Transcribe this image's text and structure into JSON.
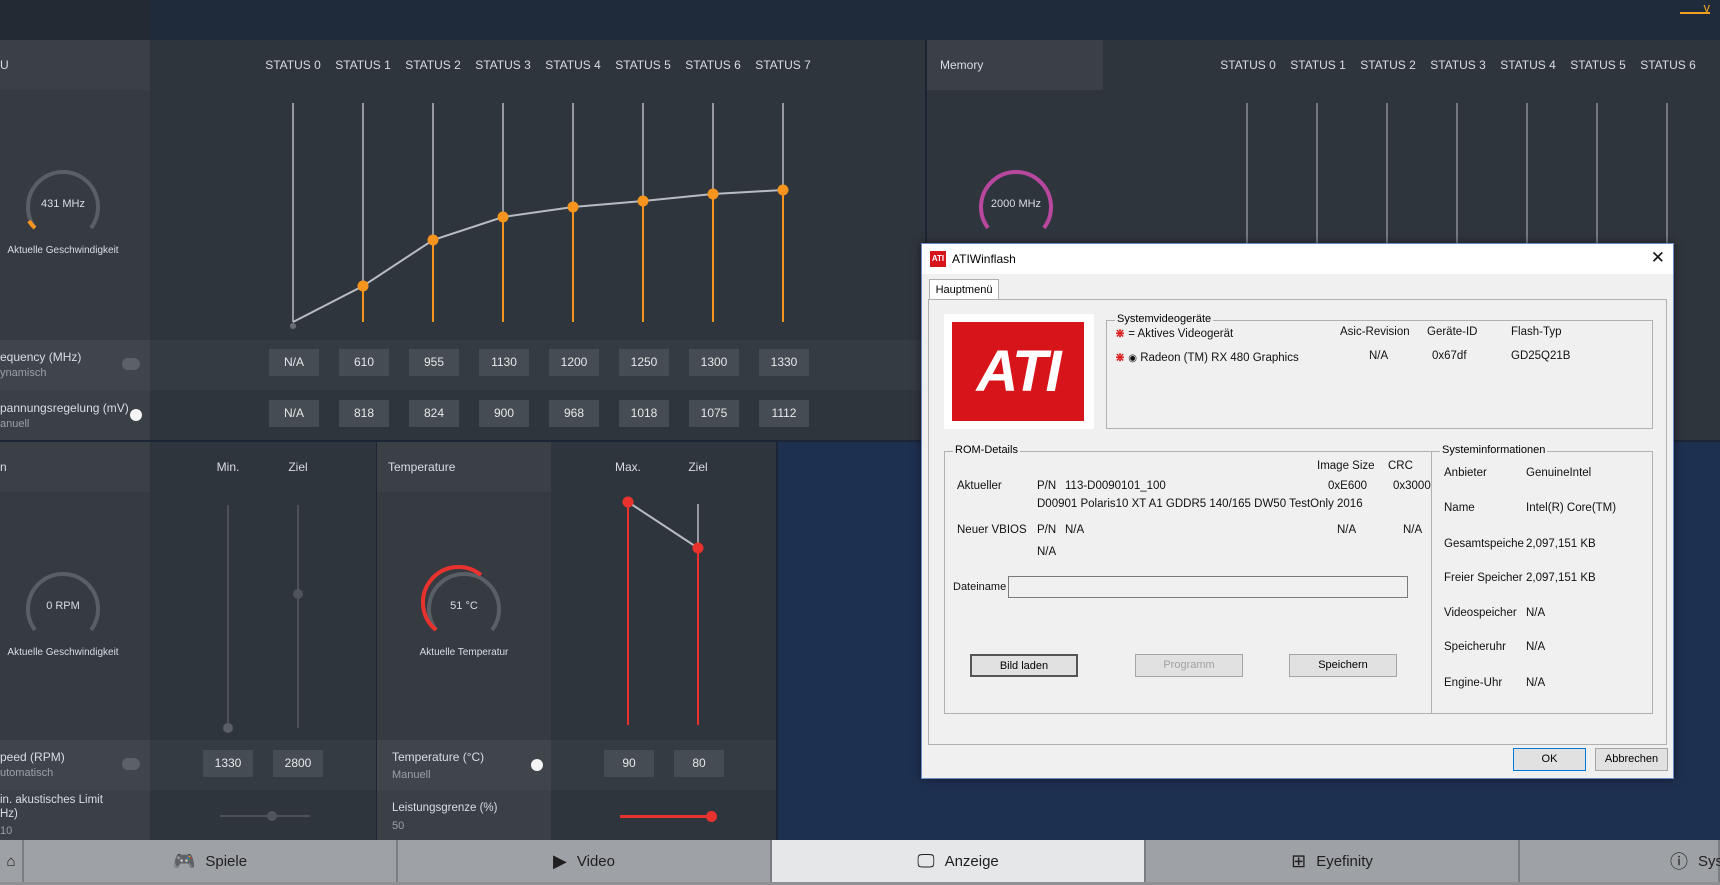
{
  "gpu": {
    "header": "U",
    "states": [
      "STATUS 0",
      "STATUS 1",
      "STATUS 2",
      "STATUS 3",
      "STATUS 4",
      "STATUS 5",
      "STATUS 6",
      "STATUS 7"
    ],
    "gauge_value": "431 MHz",
    "gauge_label": "Aktuelle Geschwindigkeit",
    "freq_label": "equency (MHz)",
    "freq_mode": "ynamisch",
    "freq_values": [
      "N/A",
      "610",
      "955",
      "1130",
      "1200",
      "1250",
      "1300",
      "1330"
    ],
    "volt_label": "pannungsregelung (mV)",
    "volt_mode": "anuell",
    "volt_values": [
      "N/A",
      "818",
      "824",
      "900",
      "968",
      "1018",
      "1075",
      "1112"
    ]
  },
  "memory": {
    "header": "Memory",
    "states": [
      "STATUS 0",
      "STATUS 1",
      "STATUS 2",
      "STATUS 3",
      "STATUS 4",
      "STATUS 5",
      "STATUS 6"
    ],
    "gauge_value": "2000 MHz"
  },
  "fan": {
    "header": "n",
    "min_label": "Min.",
    "target_label": "Ziel",
    "gauge_value": "0 RPM",
    "gauge_label": "Aktuelle Geschwindigkeit",
    "speed_label": "peed (RPM)",
    "speed_mode": "utomatisch",
    "speed_min": "1330",
    "speed_target": "2800",
    "acoustic_label_1": "in. akustisches Limit",
    "acoustic_label_2": "Hz)",
    "acoustic_value": "10"
  },
  "temperature": {
    "header": "Temperature",
    "max_label": "Max.",
    "target_label": "Ziel",
    "gauge_value": "51 °C",
    "gauge_label": "Aktuelle Temperatur",
    "temp_label": "Temperature (°C)",
    "temp_mode": "Manuell",
    "temp_max": "90",
    "temp_target": "80",
    "power_label": "Leistungsgrenze (%)",
    "power_value": "50"
  },
  "nav": {
    "items": [
      {
        "label": "Spiele",
        "icon": "gamepad-icon"
      },
      {
        "label": "Video",
        "icon": "play-icon"
      },
      {
        "label": "Anzeige",
        "icon": "monitor-icon"
      },
      {
        "label": "Eyefinity",
        "icon": "eyefinity-icon"
      },
      {
        "label": "Sys",
        "icon": "info-icon"
      }
    ]
  },
  "dialog": {
    "title": "ATIWinflash",
    "tab": "Hauptmenü",
    "logo_text": "ATI",
    "sysvideo": {
      "title": "Systemvideogeräte",
      "legend": "= Aktives Videogerät",
      "col_asic": "Asic-Revision",
      "col_device": "Geräte-ID",
      "col_flash": "Flash-Typ",
      "device": "Radeon (TM) RX 480 Graphics",
      "asic": "N/A",
      "device_id": "0x67df",
      "flash": "GD25Q21B"
    },
    "rom": {
      "title": "ROM-Details",
      "col_size": "Image Size",
      "col_crc": "CRC",
      "current_label": "Aktueller",
      "pn_label": "P/N",
      "current_pn": "113-D0090101_100",
      "current_size": "0xE600",
      "current_crc": "0x3000",
      "current_desc": "D00901 Polaris10 XT A1 GDDR5 140/165 DW50 TestOnly 2016",
      "new_label": "Neuer VBIOS",
      "new_pn": "N/A",
      "new_size": "N/A",
      "new_crc": "N/A",
      "new_desc": "N/A",
      "filename_label": "Dateiname",
      "filename_value": "",
      "btn_load": "Bild laden",
      "btn_program": "Programm",
      "btn_save": "Speichern"
    },
    "sysinfo": {
      "title": "Systeminformationen",
      "rows": [
        {
          "k": "Anbieter",
          "v": "GenuineIntel"
        },
        {
          "k": "Name",
          "v": "Intel(R) Core(TM)"
        },
        {
          "k": "Gesamtspeiche",
          "v": "2,097,151 KB"
        },
        {
          "k": "Freier Speicher",
          "v": "2,097,151 KB"
        },
        {
          "k": "Videospeicher",
          "v": "N/A"
        },
        {
          "k": "Speicheruhr",
          "v": "N/A"
        },
        {
          "k": "Engine-Uhr",
          "v": "N/A"
        }
      ]
    },
    "btn_ok": "OK",
    "btn_cancel": "Abbrechen"
  },
  "colors": {
    "accent_orange": "#f7941d",
    "accent_red": "#e8322e",
    "memory_purple": "#b8479e",
    "ati_red": "#d7141a"
  },
  "top_warning": "v"
}
